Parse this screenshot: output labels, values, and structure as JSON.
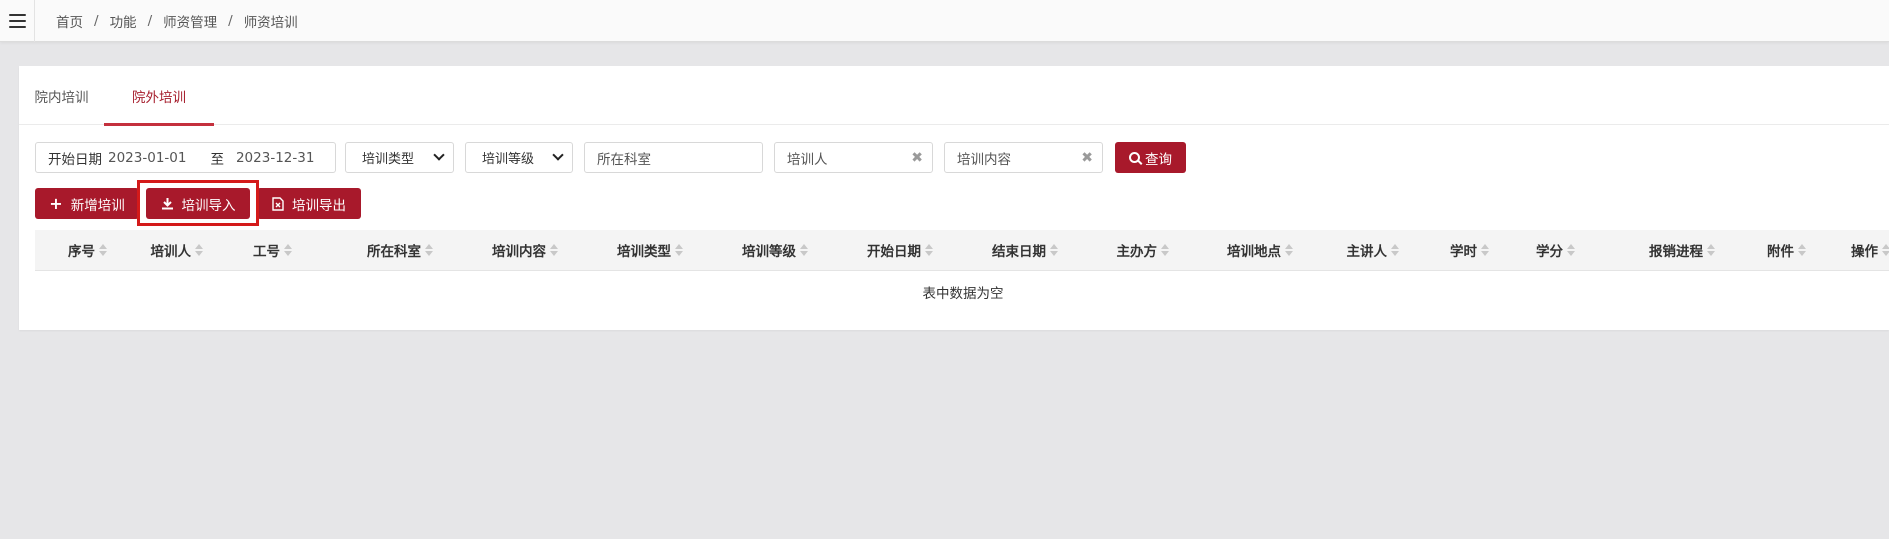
{
  "breadcrumb": [
    "首页",
    "功能",
    "师资管理",
    "师资培训"
  ],
  "tabs": [
    {
      "label": "院内培训",
      "active": false
    },
    {
      "label": "院外培训",
      "active": true
    }
  ],
  "filters": {
    "date_label": "开始日期",
    "date_start": "2023-01-01",
    "date_to": "至",
    "date_end": "2023-12-31",
    "type_select": "培训类型",
    "level_select": "培训等级",
    "dept_placeholder": "所在科室",
    "person_placeholder": "培训人",
    "content_placeholder": "培训内容",
    "clear_glyph": "✖",
    "search_label": "查询"
  },
  "actions": {
    "add_label": "新增培训",
    "import_label": "培训导入",
    "export_label": "培训导出"
  },
  "table": {
    "columns": [
      "序号",
      "培训人",
      "工号",
      "所在科室",
      "培训内容",
      "培训类型",
      "培训等级",
      "开始日期",
      "结束日期",
      "主办方",
      "培训地点",
      "主讲人",
      "学时",
      "学分",
      "报销进程",
      "附件",
      "操作"
    ],
    "empty_text": "表中数据为空"
  },
  "colors": {
    "accent": "#a8192b",
    "highlight_box": "#d41a1a",
    "page_bg": "#e6e6e8"
  }
}
